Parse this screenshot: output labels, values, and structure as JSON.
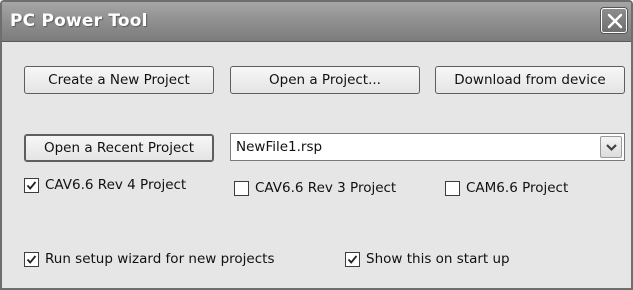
{
  "window": {
    "title": "PC Power Tool",
    "close_icon": "close-icon"
  },
  "buttons": {
    "create_new": "Create a New Project",
    "open_project": "Open a Project...",
    "download": "Download from device",
    "open_recent": "Open a Recent Project"
  },
  "recent_combo": {
    "value": "NewFile1.rsp",
    "arrow_icon": "chevron-down-icon"
  },
  "project_types": [
    {
      "label": "CAV6.6 Rev 4 Project",
      "checked": true
    },
    {
      "label": "CAV6.6 Rev 3 Project",
      "checked": false
    },
    {
      "label": "CAM6.6 Project",
      "checked": false
    }
  ],
  "options": [
    {
      "label": "Run setup wizard for new projects",
      "checked": true
    },
    {
      "label": "Show this on start up",
      "checked": true
    }
  ],
  "colors": {
    "titlebar": "#8f8f8f",
    "window_bg": "#e6e6e6"
  }
}
